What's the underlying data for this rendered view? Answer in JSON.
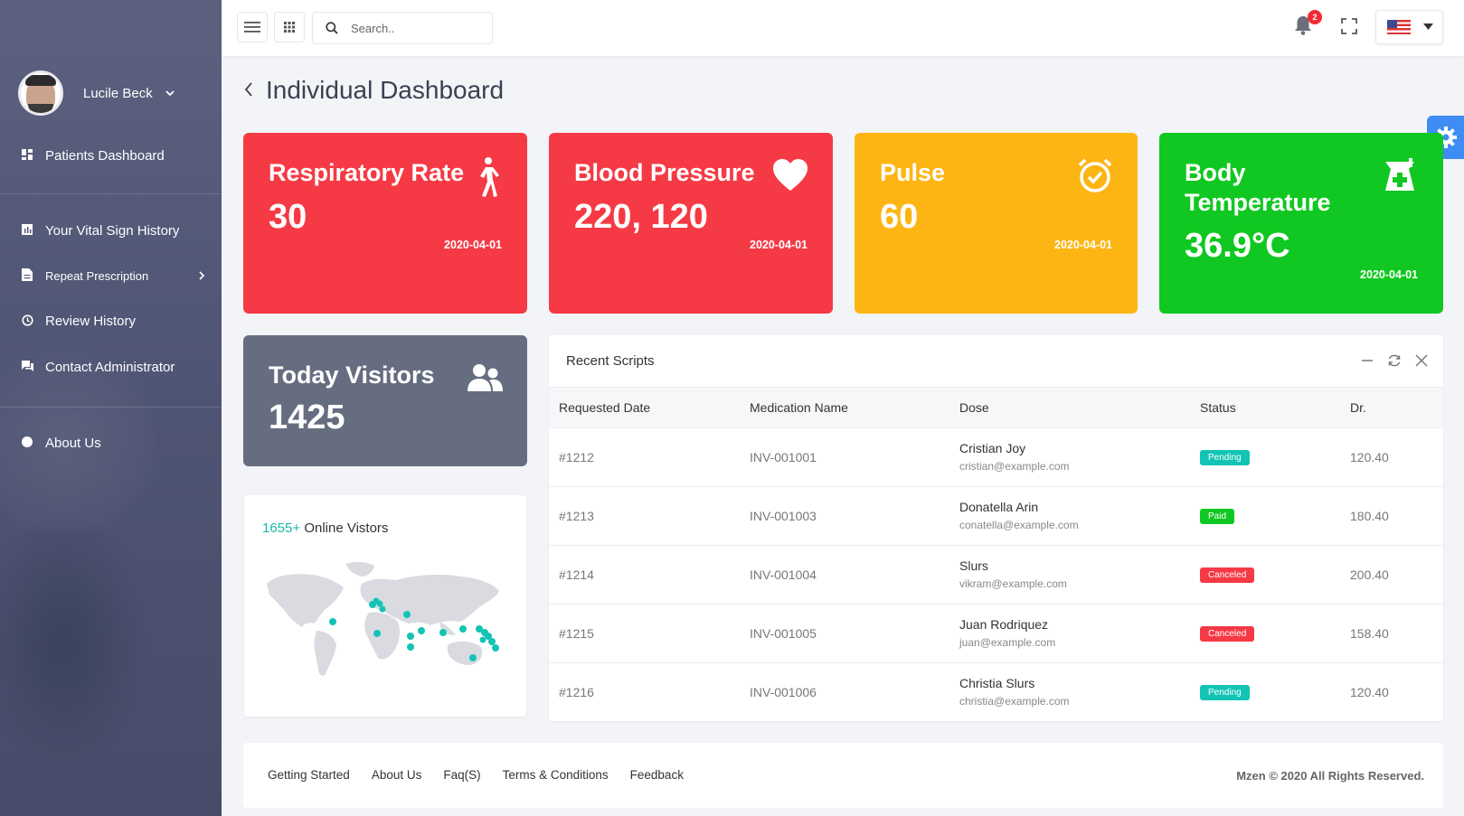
{
  "sidebar": {
    "user_name": "Lucile Beck",
    "items": [
      {
        "label": "Patients Dashboard",
        "icon": "dashboard-icon"
      },
      {
        "label": "Your Vital Sign History",
        "icon": "chart-icon"
      },
      {
        "label": "Repeat Prescription",
        "icon": "document-icon"
      },
      {
        "label": "Review History",
        "icon": "clock-icon"
      },
      {
        "label": "Contact Administrator",
        "icon": "chat-icon"
      },
      {
        "label": "About Us",
        "icon": "info-icon"
      }
    ]
  },
  "topbar": {
    "search_placeholder": "Search..",
    "notification_count": "2"
  },
  "page": {
    "title": "Individual Dashboard"
  },
  "cards": [
    {
      "title": "Respiratory Rate",
      "value": "30",
      "date": "2020-04-01",
      "color": "#f53a45",
      "icon": "walking-person-icon"
    },
    {
      "title": "Blood Pressure",
      "value": "220, 120",
      "date": "2020-04-01",
      "color": "#f53a45",
      "icon": "heart-icon"
    },
    {
      "title": "Pulse",
      "value": "60",
      "date": "2020-04-01",
      "color": "#fdb514",
      "icon": "alarm-clock-icon"
    },
    {
      "title": "Body Temperature",
      "value": "36.9°C",
      "date": "2020-04-01",
      "color": "#10c821",
      "icon": "medicine-icon"
    }
  ],
  "visitors": {
    "title": "Today Visitors",
    "value": "1425"
  },
  "online": {
    "count": "1655+",
    "label": "Online Vistors"
  },
  "scripts": {
    "title": "Recent Scripts",
    "columns": [
      "Requested Date",
      "Medication Name",
      "Dose",
      "Status",
      "Dr."
    ],
    "rows": [
      {
        "id": "#1212",
        "med": "INV-001001",
        "name": "Cristian Joy",
        "email": "cristian@example.com",
        "status": "Pending",
        "dr": "120.40"
      },
      {
        "id": "#1213",
        "med": "INV-001003",
        "name": "Donatella Arin",
        "email": "conatella@example.com",
        "status": "Paid",
        "dr": "180.40"
      },
      {
        "id": "#1214",
        "med": "INV-001004",
        "name": "Slurs",
        "email": "vikram@example.com",
        "status": "Canceled",
        "dr": "200.40"
      },
      {
        "id": "#1215",
        "med": "INV-001005",
        "name": "Juan Rodriquez",
        "email": "juan@example.com",
        "status": "Canceled",
        "dr": "158.40"
      },
      {
        "id": "#1216",
        "med": "INV-001006",
        "name": "Christia Slurs",
        "email": "christia@example.com",
        "status": "Pending",
        "dr": "120.40"
      }
    ]
  },
  "footer": {
    "links": [
      "Getting Started",
      "About Us",
      "Faq(S)",
      "Terms & Conditions",
      "Feedback"
    ],
    "copyright": "Mzen © 2020 All Rights Reserved."
  }
}
